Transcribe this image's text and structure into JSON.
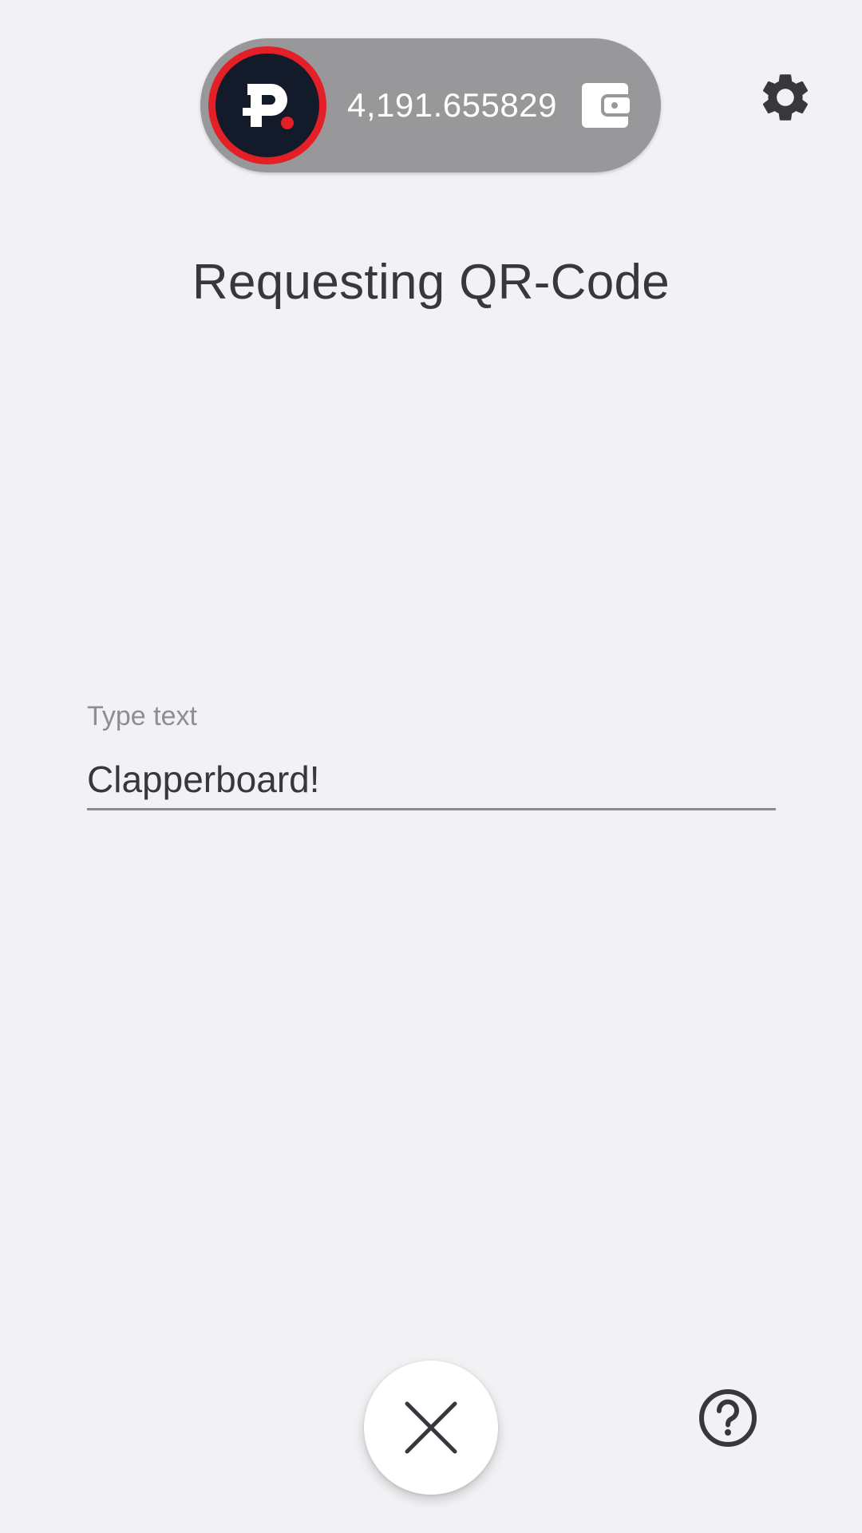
{
  "header": {
    "wallet": {
      "logo_icon": "p-coin-logo-icon",
      "balance": "4,191.655829",
      "wallet_icon": "wallet-icon"
    },
    "settings_icon": "gear-icon"
  },
  "main": {
    "title": "Requesting QR-Code",
    "text_field": {
      "label": "Type text",
      "value": "Clapperboard!"
    }
  },
  "footer": {
    "close_icon": "close-icon",
    "help_icon": "help-icon"
  },
  "colors": {
    "background": "#f2f1f4",
    "pill": "#98989b",
    "logo_ring": "#e31f28",
    "logo_fill": "#131a2a",
    "text_dark": "#38373d"
  }
}
